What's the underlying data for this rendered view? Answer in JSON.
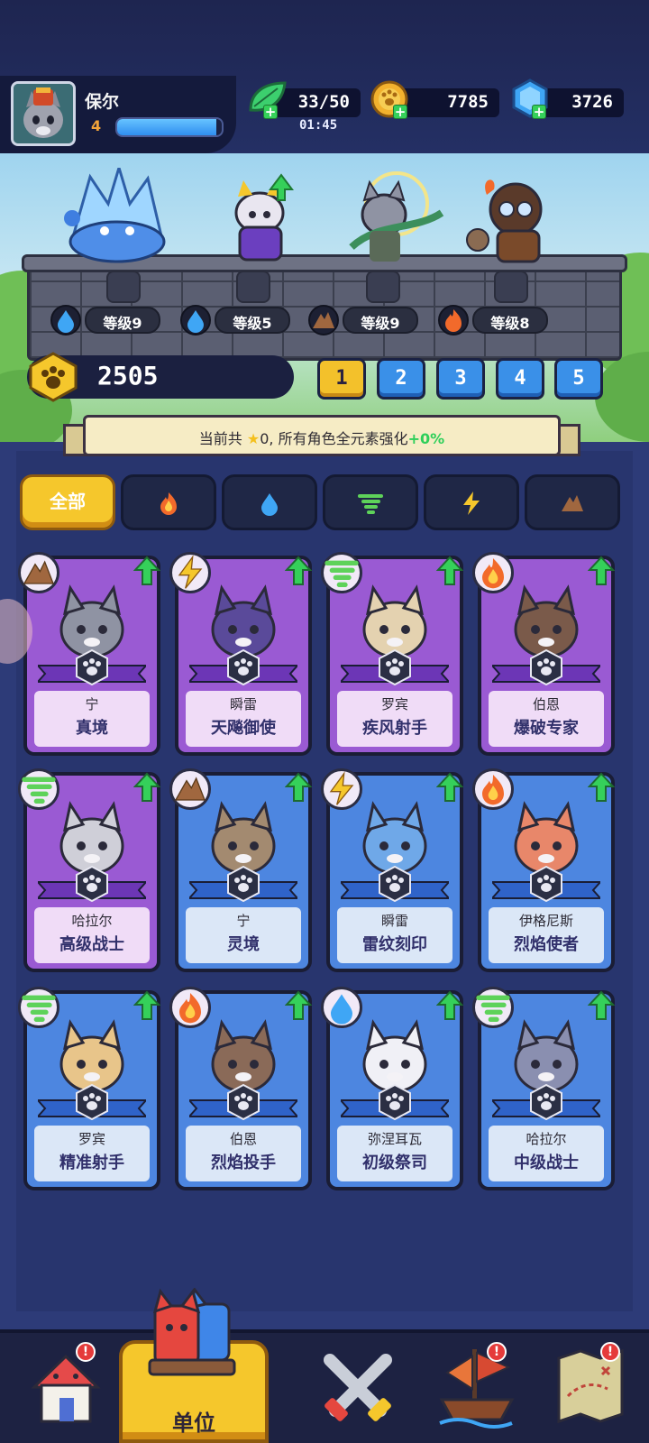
{
  "player": {
    "name": "保尔",
    "level": "4",
    "xp_progress": 0.95
  },
  "resources": {
    "energy": "33/50",
    "energy_timer": "01:45",
    "coins": "7785",
    "gems": "3726"
  },
  "lineup": {
    "slots": [
      {
        "element": "water",
        "level_label": "等级9"
      },
      {
        "element": "water",
        "level_label": "等级5"
      },
      {
        "element": "earth",
        "level_label": "等级9"
      },
      {
        "element": "fire",
        "level_label": "等级8"
      }
    ],
    "total_power": "2505",
    "teams": [
      "1",
      "2",
      "3",
      "4",
      "5"
    ],
    "active_team": "1"
  },
  "banner": {
    "prefix": "当前共",
    "star_count": "0,",
    "suffix": "所有角色全元素强化",
    "bonus": "+0%"
  },
  "filters": [
    {
      "label": "全部",
      "icon": "",
      "active": true
    },
    {
      "label": "",
      "icon": "fire-icon",
      "active": false
    },
    {
      "label": "",
      "icon": "water-icon",
      "active": false
    },
    {
      "label": "",
      "icon": "wind-icon",
      "active": false
    },
    {
      "label": "",
      "icon": "lightning-icon",
      "active": false
    },
    {
      "label": "",
      "icon": "earth-icon",
      "active": false
    }
  ],
  "units": [
    {
      "name": "宁",
      "title": "真境",
      "element": "earth",
      "rarity": "purple"
    },
    {
      "name": "瞬雷",
      "title": "天飚御使",
      "element": "lightning",
      "rarity": "purple"
    },
    {
      "name": "罗宾",
      "title": "疾风射手",
      "element": "wind",
      "rarity": "purple"
    },
    {
      "name": "伯恩",
      "title": "爆破专家",
      "element": "fire",
      "rarity": "purple"
    },
    {
      "name": "哈拉尔",
      "title": "高级战士",
      "element": "wind",
      "rarity": "purple"
    },
    {
      "name": "宁",
      "title": "灵境",
      "element": "earth",
      "rarity": "blue"
    },
    {
      "name": "瞬雷",
      "title": "雷纹刻印",
      "element": "lightning",
      "rarity": "blue"
    },
    {
      "name": "伊格尼斯",
      "title": "烈焰使者",
      "element": "fire",
      "rarity": "blue"
    },
    {
      "name": "罗宾",
      "title": "精准射手",
      "element": "wind",
      "rarity": "blue"
    },
    {
      "name": "伯恩",
      "title": "烈焰投手",
      "element": "fire",
      "rarity": "blue"
    },
    {
      "name": "弥涅耳瓦",
      "title": "初级祭司",
      "element": "water",
      "rarity": "blue"
    },
    {
      "name": "哈拉尔",
      "title": "中级战士",
      "element": "wind",
      "rarity": "blue"
    }
  ],
  "nav": {
    "items": [
      {
        "icon": "home-icon",
        "badge": "!"
      },
      {
        "icon": "units-icon",
        "label": "单位"
      },
      {
        "icon": "battle-icon"
      },
      {
        "icon": "ship-icon",
        "badge": "!"
      },
      {
        "icon": "map-icon",
        "badge": "!"
      }
    ]
  },
  "colors": {
    "accent_gold": "#f5c72c",
    "rarity_purple": "#9a5ad3",
    "rarity_blue": "#4d86e0",
    "upgrade_green": "#35d05a"
  }
}
